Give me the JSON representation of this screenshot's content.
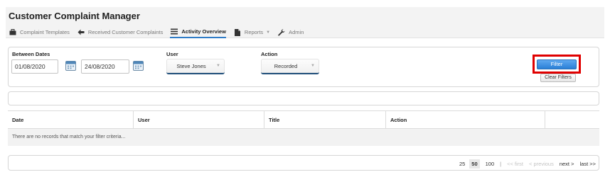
{
  "app": {
    "title": "Customer Complaint Manager"
  },
  "nav": {
    "items": [
      {
        "label": "Complaint Templates",
        "icon": "briefcase-icon"
      },
      {
        "label": "Received Customer Complaints",
        "icon": "arrow-left-icon"
      },
      {
        "label": "Activity Overview",
        "icon": "list-icon",
        "active": true
      },
      {
        "label": "Reports",
        "icon": "document-icon",
        "has_dropdown": true
      },
      {
        "label": "Admin",
        "icon": "wrench-icon"
      }
    ]
  },
  "filters": {
    "between_dates_label": "Between Dates",
    "date_from": "01/08/2020",
    "date_to": "24/08/2020",
    "user_label": "User",
    "user_value": "Steve Jones",
    "action_label": "Action",
    "action_value": "Recorded",
    "filter_button": "Filter",
    "clear_button": "Clear Filters"
  },
  "table": {
    "columns": [
      "Date",
      "User",
      "Title",
      "Action"
    ],
    "empty_message": "There are no records that match your filter criteria..."
  },
  "pagination": {
    "page_sizes": [
      "25",
      "50",
      "100"
    ],
    "selected_page_size": "50",
    "separator": "|",
    "first": "<< first",
    "previous": "< previous",
    "next": "next >",
    "last": "last >>"
  },
  "colors": {
    "accent": "#2f7cc7",
    "filter_button": "#2a7fd6",
    "highlight": "#e00000",
    "select_underline": "#1f4e7a"
  }
}
